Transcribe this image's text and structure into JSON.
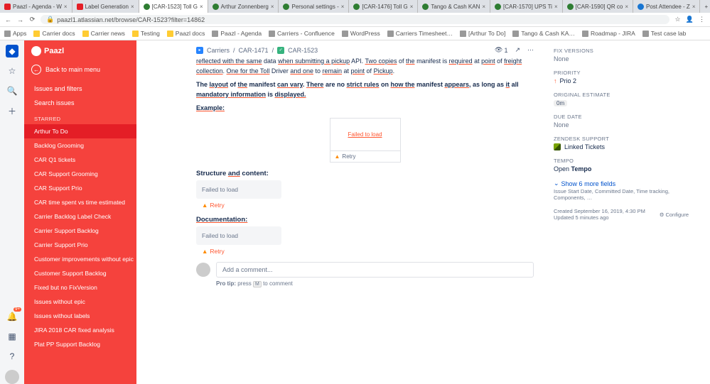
{
  "browser": {
    "tabs": [
      {
        "label": "Paazl - Agenda - W",
        "fav": "fav-p"
      },
      {
        "label": "Label Generation",
        "fav": "fav-p"
      },
      {
        "label": "[CAR-1523] Toll G",
        "fav": "fav-g",
        "active": true
      },
      {
        "label": "Arthur Zonnenberg",
        "fav": "fav-g"
      },
      {
        "label": "Personal settings -",
        "fav": "fav-g"
      },
      {
        "label": "[CAR-1476] Toll G",
        "fav": "fav-g"
      },
      {
        "label": "Tango & Cash KAN",
        "fav": "fav-g"
      },
      {
        "label": "[CAR-1570] UPS Ti",
        "fav": "fav-g"
      },
      {
        "label": "[CAR-1590] QR co",
        "fav": "fav-g"
      },
      {
        "label": "Post Attendee - Z",
        "fav": "fav-b"
      }
    ],
    "url": "paazl1.atlassian.net/browse/CAR-1523?filter=14862",
    "bookmarks": [
      {
        "label": "Apps",
        "ico": "g"
      },
      {
        "label": "Carrier docs",
        "ico": ""
      },
      {
        "label": "Carrier news",
        "ico": ""
      },
      {
        "label": "Testing",
        "ico": ""
      },
      {
        "label": "Paazl docs",
        "ico": ""
      },
      {
        "label": "Paazl - Agenda",
        "ico": "g"
      },
      {
        "label": "Carriers - Confluence",
        "ico": "g"
      },
      {
        "label": "WordPress",
        "ico": "g"
      },
      {
        "label": "Carriers Timesheet…",
        "ico": "g"
      },
      {
        "label": "[Arthur To Do]",
        "ico": "g"
      },
      {
        "label": "Tango & Cash KA…",
        "ico": "g"
      },
      {
        "label": "Roadmap - JIRA",
        "ico": "g"
      },
      {
        "label": "Test case lab",
        "ico": "g"
      }
    ]
  },
  "sidebar": {
    "brand": "Paazl",
    "back": "Back to main menu",
    "links": [
      "Issues and filters",
      "Search issues"
    ],
    "starred_label": "STARRED",
    "filters": [
      {
        "label": "Arthur To Do",
        "active": true
      },
      {
        "label": "Backlog Grooming"
      },
      {
        "label": "CAR Q1 tickets"
      },
      {
        "label": "CAR Support Grooming"
      },
      {
        "label": "CAR Support Prio"
      },
      {
        "label": "CAR time spent vs time estimated"
      },
      {
        "label": "Carrier Backlog Label Check"
      },
      {
        "label": "Carrier Support Backlog"
      },
      {
        "label": "Carrier Support Prio"
      },
      {
        "label": "Customer improvements without epic"
      },
      {
        "label": "Customer Support Backlog"
      },
      {
        "label": "Fixed but no FixVersion"
      },
      {
        "label": "Issues without epic"
      },
      {
        "label": "Issues without labels"
      },
      {
        "label": "JIRA 2018 CAR fixed analysis"
      },
      {
        "label": "Plat PP Support Backlog"
      }
    ]
  },
  "breadcrumb": {
    "project": "Carriers",
    "parent": "CAR-1471",
    "key": "CAR-1523",
    "watchers": "1"
  },
  "description": {
    "line1a": "reflected with the same",
    "line1b": " data ",
    "line1c": "when submitting a pickup",
    "line1d": " API. ",
    "line1e": "Two copies",
    "line1f": " of ",
    "line1g": "the",
    "line1h": " manifest is ",
    "line1i": "required",
    "line1j": " at ",
    "line1k": "point",
    "line1l": " of ",
    "line1m": "freight collection",
    "line1n": ". ",
    "line1o": "One for the Toll",
    "line1p": " Driver ",
    "line1q": "and one",
    "line1r": " to ",
    "line1s": "remain",
    "line1t": " at ",
    "line1u": "point",
    "line1v": " of ",
    "line1w": "Pickup",
    "line1x": ".",
    "line2a": "The ",
    "line2b": "layout",
    "line2c": " of ",
    "line2d": "the",
    "line2e": " manifest ",
    "line2f": "can vary",
    "line2g": ". ",
    "line2h": "There",
    "line2i": " are no ",
    "line2j": "strict rules",
    "line2k": " on ",
    "line2l": "how the",
    "line2m": " manifest ",
    "line2n": "appears",
    "line2o": ", as long as ",
    "line2p": "it",
    "line2q": " all ",
    "line2r": "mandatory information",
    "line2s": " is ",
    "line2t": "displayed.",
    "example": "Example:",
    "failed": "Failed to load",
    "retry": "Retry",
    "sec1": "Structure ",
    "sec1b": "and",
    "sec1c": " content:",
    "sec2": "Documentation:"
  },
  "comment": {
    "placeholder": "Add a comment...",
    "tip_a": "Pro tip:",
    "tip_b": " press ",
    "tip_key": "M",
    "tip_c": " to comment"
  },
  "panel": {
    "fix_label": "FIX VERSIONS",
    "fix_val": "None",
    "prio_label": "PRIORITY",
    "prio_val": "Prio 2",
    "oe_label": "ORIGINAL ESTIMATE",
    "oe_val": "0m",
    "due_label": "DUE DATE",
    "due_val": "None",
    "zen_label": "ZENDESK SUPPORT",
    "zen_val": "Linked Tickets",
    "tempo_label": "TEMPO",
    "tempo_open": "Open ",
    "tempo_val": "Tempo",
    "show_more": "Show 6 more fields",
    "show_sub": "Issue Start Date, Committed Date, Time tracking, Components, …",
    "created": "Created September 16, 2019, 4:30 PM",
    "updated": "Updated 5 minutes ago",
    "configure": "Configure"
  }
}
